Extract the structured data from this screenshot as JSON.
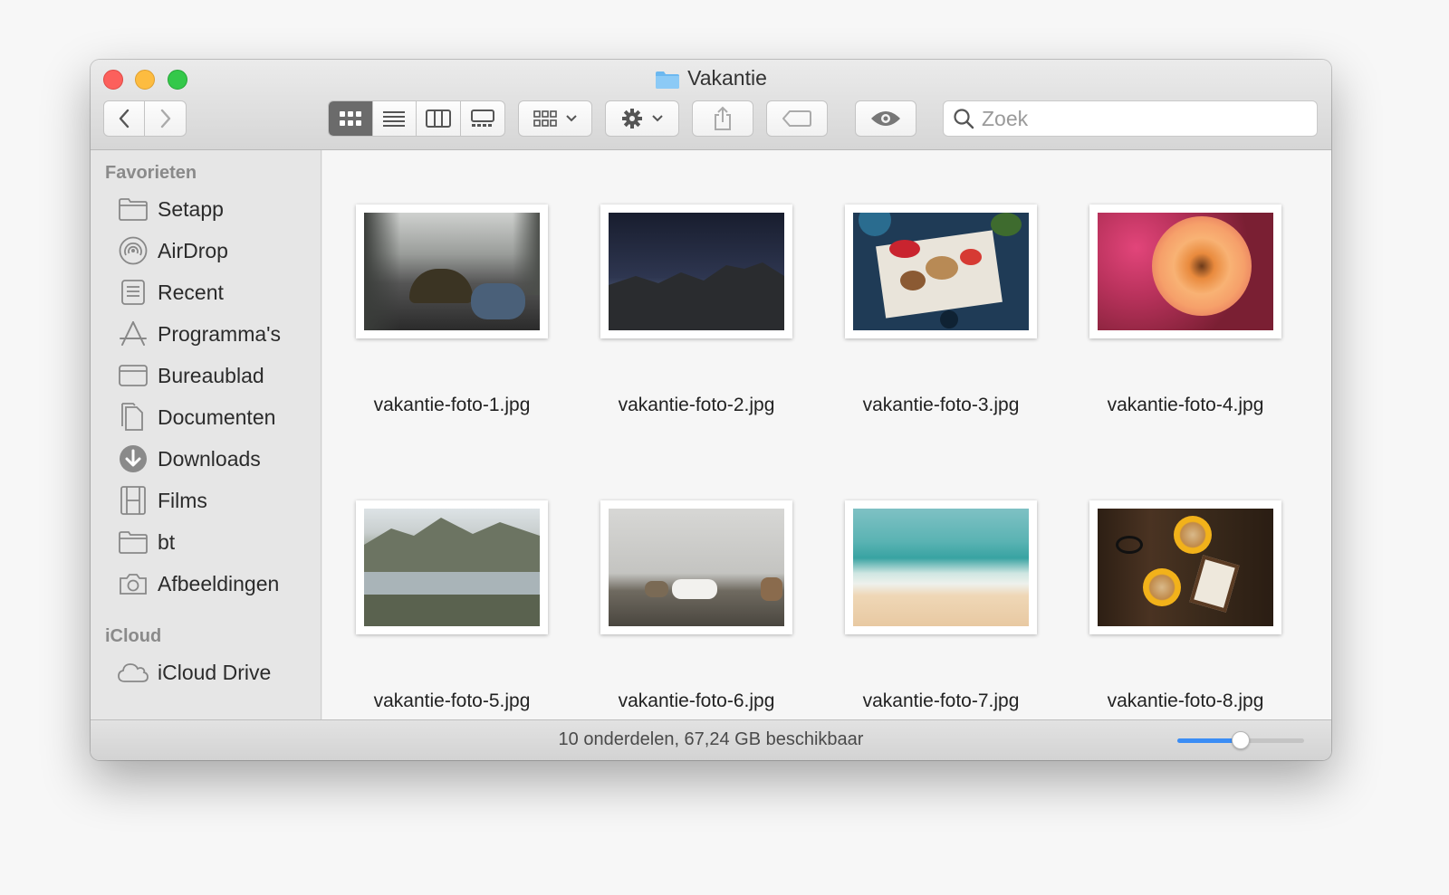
{
  "window": {
    "title": "Vakantie",
    "title_icon": "folder-icon"
  },
  "toolbar": {
    "back": "chevron-left-icon",
    "forward": "chevron-right-icon",
    "view_modes": [
      {
        "name": "icon-view",
        "icon": "grid-icon",
        "active": true
      },
      {
        "name": "list-view",
        "icon": "list-icon",
        "active": false
      },
      {
        "name": "column-view",
        "icon": "columns-icon",
        "active": false
      },
      {
        "name": "gallery-view",
        "icon": "gallery-icon",
        "active": false
      }
    ],
    "group_by_icon": "grid-icon",
    "action_icon": "gear-icon",
    "share_icon": "share-icon",
    "tag_icon": "tag-icon",
    "quicklook_icon": "eye-icon",
    "search": {
      "placeholder": "Zoek",
      "value": ""
    }
  },
  "sidebar": {
    "favorites_label": "Favorieten",
    "favorites": [
      {
        "label": "Setapp",
        "icon": "folder-icon"
      },
      {
        "label": "AirDrop",
        "icon": "airdrop-icon"
      },
      {
        "label": "Recent",
        "icon": "recent-icon"
      },
      {
        "label": "Programma's",
        "icon": "applications-icon"
      },
      {
        "label": "Bureaublad",
        "icon": "desktop-icon"
      },
      {
        "label": "Documenten",
        "icon": "documents-icon"
      },
      {
        "label": "Downloads",
        "icon": "downloads-icon"
      },
      {
        "label": "Films",
        "icon": "film-icon"
      },
      {
        "label": "bt",
        "icon": "folder-icon"
      },
      {
        "label": "Afbeeldingen",
        "icon": "camera-icon"
      }
    ],
    "icloud_label": "iCloud",
    "icloud": [
      {
        "label": "iCloud Drive",
        "icon": "cloud-icon"
      }
    ]
  },
  "files": [
    {
      "name": "vakantie-foto-1.jpg",
      "subject": "car dashboard with cap in fog"
    },
    {
      "name": "vakantie-foto-2.jpg",
      "subject": "mountain silhouette at dusk"
    },
    {
      "name": "vakantie-foto-3.jpg",
      "subject": "food platter on blue table"
    },
    {
      "name": "vakantie-foto-4.jpg",
      "subject": "orange rose"
    },
    {
      "name": "vakantie-foto-5.jpg",
      "subject": "mountain lake reflection"
    },
    {
      "name": "vakantie-foto-6.jpg",
      "subject": "horses on a field"
    },
    {
      "name": "vakantie-foto-7.jpg",
      "subject": "beach and sea"
    },
    {
      "name": "vakantie-foto-8.jpg",
      "subject": "coffee cups on wooden table"
    }
  ],
  "status": {
    "text": "10 onderdelen, 67,24 GB beschikbaar",
    "icon_size_fraction": 0.5
  }
}
